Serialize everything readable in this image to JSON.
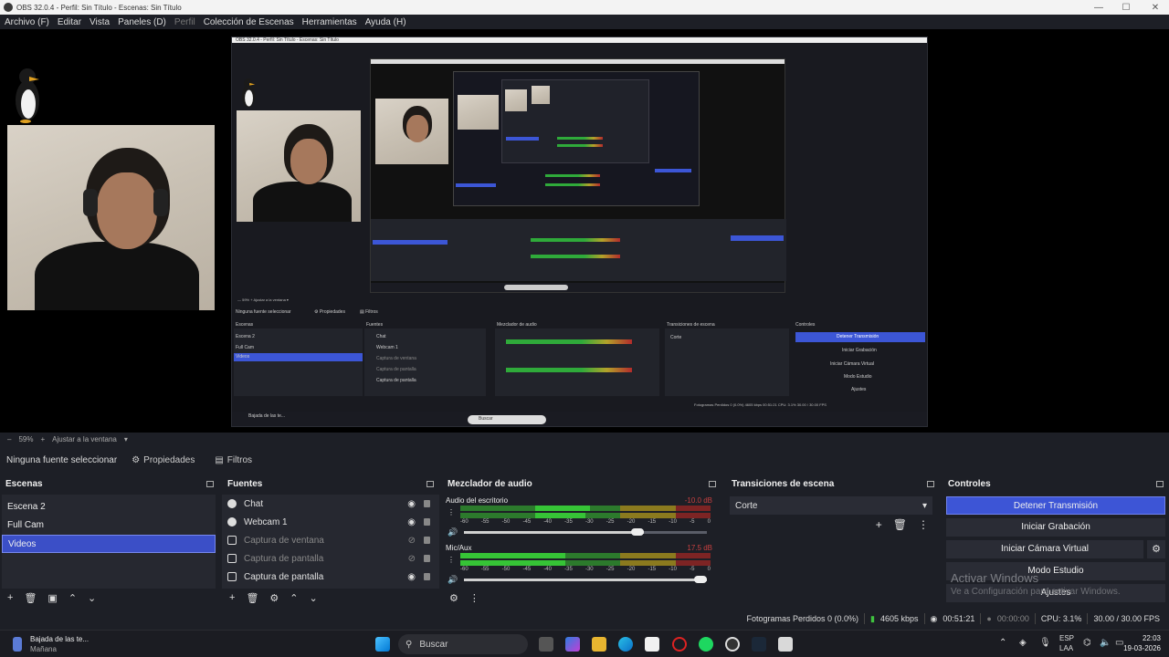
{
  "window": {
    "title": "OBS 32.0.4 - Perfil: Sin Título - Escenas: Sin Título"
  },
  "menu": {
    "items": [
      "Archivo (F)",
      "Editar",
      "Vista",
      "Paneles (D)",
      "Perfil",
      "Colección de Escenas",
      "Herramientas",
      "Ayuda (H)"
    ]
  },
  "zoom": {
    "percent": "59%",
    "fit_label": "Ajustar a la ventana"
  },
  "source_toolbar": {
    "no_source": "Ninguna fuente seleccionar",
    "properties": "Propiedades",
    "filters": "Filtros"
  },
  "scenes": {
    "title": "Escenas",
    "items": [
      "Escena 2",
      "Full Cam",
      "Videos"
    ],
    "selected": "Videos"
  },
  "sources": {
    "title": "Fuentes",
    "items": [
      {
        "name": "Chat",
        "icon": "browser-icon",
        "visible": true
      },
      {
        "name": "Webcam 1",
        "icon": "camera-icon",
        "visible": true
      },
      {
        "name": "Captura de ventana",
        "icon": "window-capture-icon",
        "visible": false
      },
      {
        "name": "Captura de pantalla",
        "icon": "display-capture-icon",
        "visible": false
      },
      {
        "name": "Captura de pantalla",
        "icon": "display-capture-icon",
        "visible": true
      }
    ]
  },
  "mixer": {
    "title": "Mezclador de audio",
    "channels": [
      {
        "name": "Audio del escritorio",
        "db": "-10.0 dB",
        "level": 0.74
      },
      {
        "name": "Mic/Aux",
        "db": "17.5 dB",
        "level": 1.0
      }
    ],
    "ticks": [
      "-60",
      "-55",
      "-50",
      "-45",
      "-40",
      "-35",
      "-30",
      "-25",
      "-20",
      "-15",
      "-10",
      "-5",
      "0"
    ]
  },
  "transitions": {
    "title": "Transiciones de escena",
    "selected": "Corte"
  },
  "controls": {
    "title": "Controles",
    "buttons": [
      "Detener Transmisión",
      "Iniciar Grabación",
      "Iniciar Cámara Virtual",
      "Modo Estudio",
      "Ajustes"
    ]
  },
  "watermark": {
    "line1": "Activar Windows",
    "line2": "Ve a Configuración para activar Windows."
  },
  "status": {
    "dropped": "Fotogramas Perdidos 0 (0.0%)",
    "bitrate": "4605 kbps",
    "stream_time": "00:51:21",
    "rec_time": "00:00:00",
    "cpu": "CPU: 3.1%",
    "fps": "30.00 / 30.00 FPS"
  },
  "taskbar": {
    "notification_title": "Bajada de las te...",
    "notification_sub": "Mañana",
    "search_placeholder": "Buscar",
    "lang1": "ESP",
    "lang2": "LAA",
    "time": "22:03",
    "date": "19-03-2026"
  },
  "nested": {
    "title": "OBS 32.0.4 - Perfil: Sin Título - Escenas: Sin Título",
    "no_source": "Ninguna fuente seleccionar",
    "scenes": [
      "Escena 2",
      "Full Cam",
      "Videos"
    ],
    "sources": [
      "Chat",
      "Webcam 1",
      "Captura de ventana",
      "Captura de pantalla",
      "Captura de pantalla"
    ],
    "controls": [
      "Detener Transmisión",
      "Iniciar Grabación",
      "Iniciar Cámara Virtual",
      "Modo Estudio",
      "Ajustes"
    ],
    "transition": "Corte",
    "status": "Fotogramas Perdidos 0 (0.0%)   4605 kbps   00:51:21   CPU: 3.1%   30.00 / 30.00 FPS"
  }
}
